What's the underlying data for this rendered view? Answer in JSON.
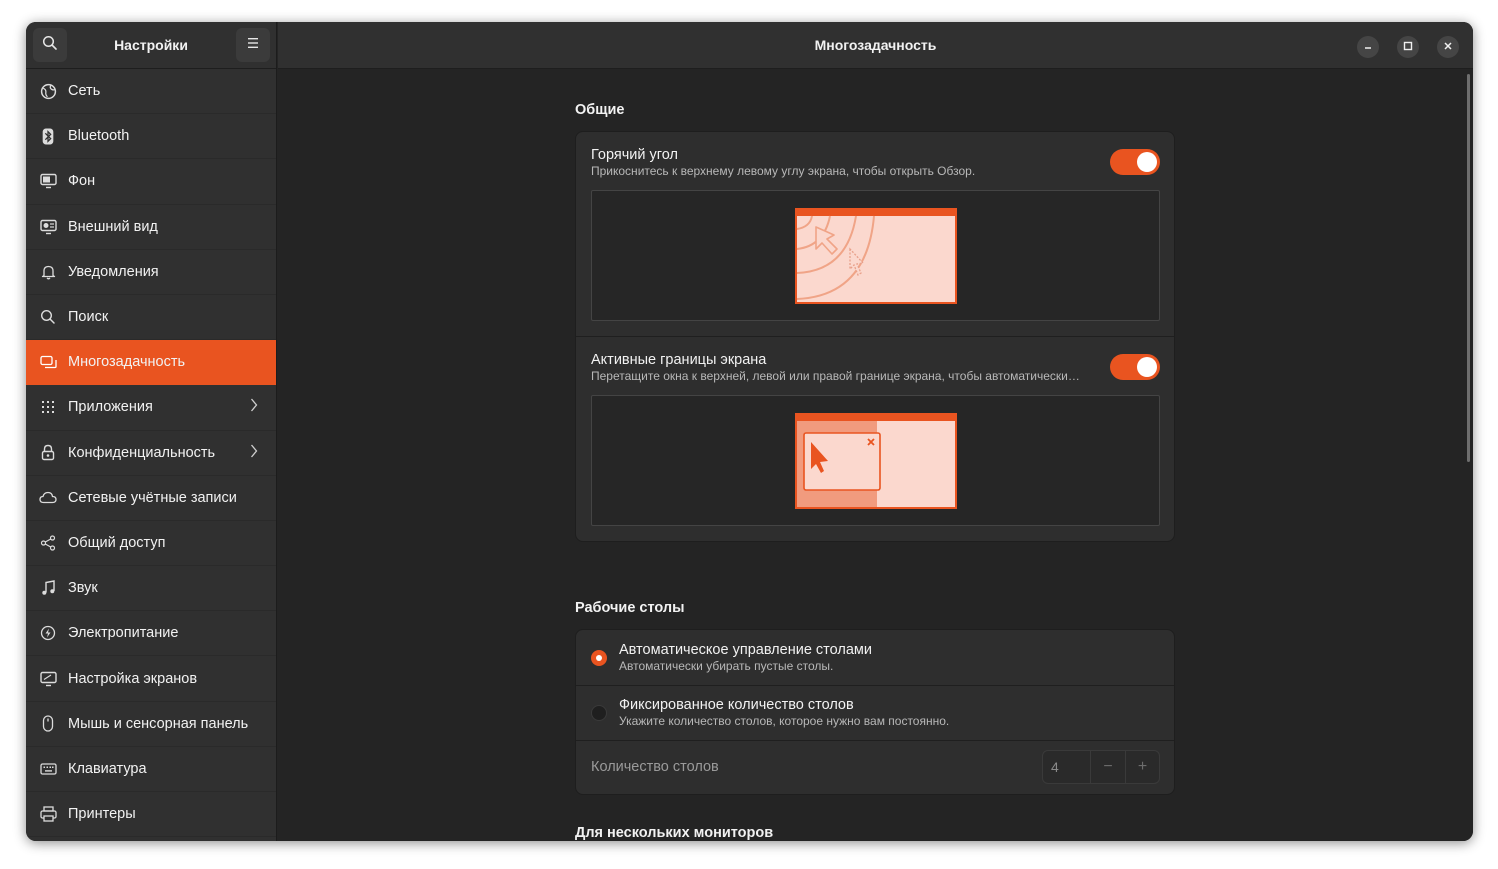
{
  "sidebar": {
    "title": "Настройки",
    "items": [
      {
        "label": "Сеть",
        "icon": "globe-icon"
      },
      {
        "label": "Bluetooth",
        "icon": "bluetooth-icon"
      },
      {
        "label": "Фон",
        "icon": "background-icon"
      },
      {
        "label": "Внешний вид",
        "icon": "appearance-icon"
      },
      {
        "label": "Уведомления",
        "icon": "bell-icon"
      },
      {
        "label": "Поиск",
        "icon": "search-icon"
      },
      {
        "label": "Многозадачность",
        "icon": "multitasking-icon",
        "active": true
      },
      {
        "label": "Приложения",
        "icon": "apps-grid-icon",
        "has_submenu": true
      },
      {
        "label": "Конфиденциальность",
        "icon": "lock-icon",
        "has_submenu": true
      },
      {
        "label": "Сетевые учётные записи",
        "icon": "cloud-icon"
      },
      {
        "label": "Общий доступ",
        "icon": "share-icon"
      },
      {
        "label": "Звук",
        "icon": "music-note-icon"
      },
      {
        "label": "Электропитание",
        "icon": "power-icon"
      },
      {
        "label": "Настройка экранов",
        "icon": "display-icon"
      },
      {
        "label": "Мышь и сенсорная панель",
        "icon": "mouse-icon"
      },
      {
        "label": "Клавиатура",
        "icon": "keyboard-icon"
      },
      {
        "label": "Принтеры",
        "icon": "printer-icon"
      }
    ]
  },
  "header": {
    "title": "Многозадачность"
  },
  "general": {
    "section_title": "Общие",
    "hot_corner": {
      "title": "Горячий угол",
      "subtitle": "Прикоснитесь к верхнему левому углу экрана, чтобы открыть Обзор.",
      "enabled": true
    },
    "active_edges": {
      "title": "Активные границы экрана",
      "subtitle": "Перетащите окна к верхней, левой или правой границе экрана, чтобы автоматически…",
      "enabled": true
    }
  },
  "workspaces": {
    "section_title": "Рабочие столы",
    "dynamic": {
      "title": "Автоматическое управление столами",
      "subtitle": "Автоматически убирать пустые столы.",
      "selected": true
    },
    "fixed": {
      "title": "Фиксированное количество столов",
      "subtitle": "Укажите количество столов, которое нужно вам постоянно.",
      "selected": false
    },
    "count": {
      "label": "Количество столов",
      "value": "4",
      "minus": "−",
      "plus": "+"
    }
  },
  "multi_monitor": {
    "section_title": "Для нескольких мониторов"
  },
  "colors": {
    "accent": "#e95420",
    "window_bg": "#242424",
    "sidebar_bg": "#303030",
    "card_bg": "#2e2e2e",
    "illustration_bg": "#fbd8ce"
  }
}
